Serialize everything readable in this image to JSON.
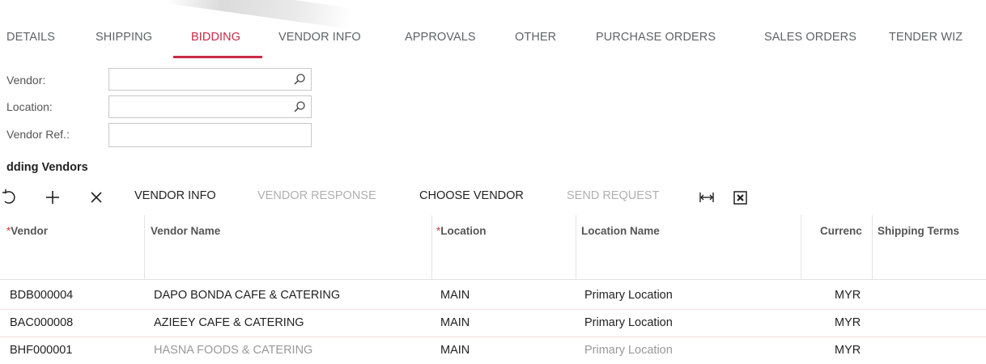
{
  "tabs": [
    {
      "label": "DETAILS"
    },
    {
      "label": "SHIPPING"
    },
    {
      "label": "BIDDING"
    },
    {
      "label": "VENDOR INFO"
    },
    {
      "label": "APPROVALS"
    },
    {
      "label": "OTHER"
    },
    {
      "label": "PURCHASE ORDERS"
    },
    {
      "label": "SALES ORDERS"
    },
    {
      "label": "TENDER WIZ"
    }
  ],
  "active_tab": "BIDDING",
  "accent_color": "#c62b45",
  "form": {
    "vendor_label": "Vendor:",
    "vendor_value": "",
    "location_label": "Location:",
    "location_value": "",
    "vendor_ref_label": "Vendor Ref.:",
    "vendor_ref_value": ""
  },
  "section": {
    "title": "dding Vendors"
  },
  "toolbar": {
    "refresh_icon": "refresh-icon",
    "add_icon": "plus-icon",
    "delete_icon": "close-icon",
    "vendor_info": "VENDOR INFO",
    "vendor_response": "VENDOR RESPONSE",
    "choose_vendor": "CHOOSE VENDOR",
    "send_request": "SEND REQUEST",
    "fit_icon": "fit-width-icon",
    "excel_icon": "excel-export-icon"
  },
  "grid": {
    "columns": [
      {
        "label": "Vendor",
        "required": true
      },
      {
        "label": "Vendor Name",
        "required": false
      },
      {
        "label": "Location",
        "required": true
      },
      {
        "label": "Location Name",
        "required": false
      },
      {
        "label": "Currenc",
        "required": false
      },
      {
        "label": "Shipping Terms",
        "required": false
      }
    ],
    "required_marker": "*",
    "rows": [
      {
        "vendor": "BDB000004",
        "vendor_name": "DAPO BONDA CAFE & CATERING",
        "location": "MAIN",
        "location_name": "Primary Location",
        "currency": "MYR",
        "shipping_terms": ""
      },
      {
        "vendor": "BAC000008",
        "vendor_name": "AZIEEY CAFE & CATERING",
        "location": "MAIN",
        "location_name": "Primary Location",
        "currency": "MYR",
        "shipping_terms": ""
      },
      {
        "vendor": "BHF000001",
        "vendor_name": "HASNA FOODS & CATERING",
        "location": "MAIN",
        "location_name": "Primary Location",
        "currency": "MYR",
        "shipping_terms": ""
      }
    ]
  }
}
